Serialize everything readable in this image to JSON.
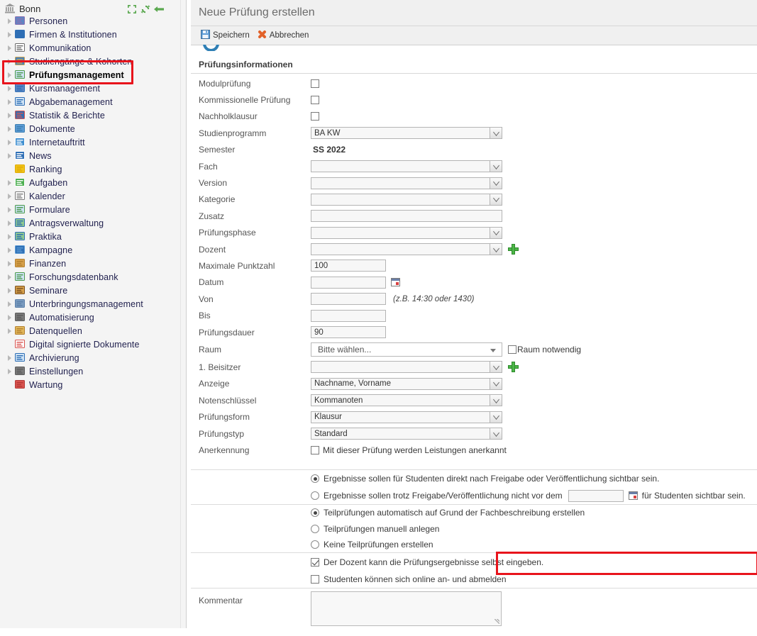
{
  "sidebar": {
    "root": {
      "label": "Bonn",
      "icon": "bank-icon"
    },
    "tools": [
      {
        "name": "collapse-all-icon",
        "label": "↕"
      },
      {
        "name": "refresh-icon",
        "label": "↻"
      },
      {
        "name": "back-arrow-icon",
        "label": "←"
      }
    ],
    "items": [
      {
        "label": "Personen",
        "icon": "people-icon",
        "expandable": true,
        "active": false
      },
      {
        "label": "Firmen & Institutionen",
        "icon": "factory-icon",
        "expandable": true,
        "active": false
      },
      {
        "label": "Kommunikation",
        "icon": "envelope-icon",
        "expandable": true,
        "active": false
      },
      {
        "label": "Studiengänge & Kohorten",
        "icon": "graduation-icon",
        "expandable": true,
        "active": false
      },
      {
        "label": "Prüfungsmanagement",
        "icon": "exam-icon",
        "expandable": true,
        "active": true
      },
      {
        "label": "Kursmanagement",
        "icon": "book-icon",
        "expandable": true,
        "active": false
      },
      {
        "label": "Abgabemanagement",
        "icon": "card-icon",
        "expandable": true,
        "active": false
      },
      {
        "label": "Statistik & Berichte",
        "icon": "bar-chart-icon",
        "expandable": true,
        "active": false
      },
      {
        "label": "Dokumente",
        "icon": "folder-icon",
        "expandable": true,
        "active": false
      },
      {
        "label": "Internetauftritt",
        "icon": "globe-icon",
        "expandable": true,
        "active": false
      },
      {
        "label": "News",
        "icon": "info-icon",
        "expandable": true,
        "active": false
      },
      {
        "label": "Ranking",
        "icon": "star-icon",
        "expandable": false,
        "active": false
      },
      {
        "label": "Aufgaben",
        "icon": "clock-icon",
        "expandable": true,
        "active": false
      },
      {
        "label": "Kalender",
        "icon": "calendar-icon",
        "expandable": true,
        "active": false
      },
      {
        "label": "Formulare",
        "icon": "form-icon",
        "expandable": true,
        "active": false
      },
      {
        "label": "Antragsverwaltung",
        "icon": "application-icon",
        "expandable": true,
        "active": false
      },
      {
        "label": "Praktika",
        "icon": "internship-icon",
        "expandable": true,
        "active": false
      },
      {
        "label": "Kampagne",
        "icon": "campaign-icon",
        "expandable": true,
        "active": false
      },
      {
        "label": "Finanzen",
        "icon": "coins-icon",
        "expandable": true,
        "active": false
      },
      {
        "label": "Forschungsdatenbank",
        "icon": "research-chart-icon",
        "expandable": true,
        "active": false
      },
      {
        "label": "Seminare",
        "icon": "briefcase-icon",
        "expandable": true,
        "active": false
      },
      {
        "label": "Unterbringungsmanagement",
        "icon": "building-icon",
        "expandable": true,
        "active": false
      },
      {
        "label": "Automatisierung",
        "icon": "gear-icon",
        "expandable": true,
        "active": false
      },
      {
        "label": "Datenquellen",
        "icon": "database-icon",
        "expandable": true,
        "active": false
      },
      {
        "label": "Digital signierte Dokumente",
        "icon": "signed-document-icon",
        "expandable": false,
        "active": false
      },
      {
        "label": "Archivierung",
        "icon": "archive-icon",
        "expandable": true,
        "active": false
      },
      {
        "label": "Einstellungen",
        "icon": "gear-icon",
        "expandable": true,
        "active": false
      },
      {
        "label": "Wartung",
        "icon": "toolbox-icon",
        "expandable": false,
        "active": false
      }
    ]
  },
  "header": {
    "title": "Neue Prüfung erstellen"
  },
  "toolbar": {
    "save_label": "Speichern",
    "save_icon": "floppy-disk-icon",
    "cancel_label": "Abbrechen",
    "cancel_icon": "red-x-icon"
  },
  "section": {
    "title": "Prüfungsinformationen"
  },
  "fields": {
    "modulpruefung": {
      "label": "Modulprüfung",
      "checked": false
    },
    "kommissionelle": {
      "label": "Kommissionelle Prüfung",
      "checked": false
    },
    "nachholklausur": {
      "label": "Nachholklausur",
      "checked": false
    },
    "studienprogramm": {
      "label": "Studienprogramm",
      "value": "BA KW"
    },
    "semester": {
      "label": "Semester",
      "value": "SS 2022"
    },
    "fach": {
      "label": "Fach",
      "value": ""
    },
    "version": {
      "label": "Version",
      "value": ""
    },
    "kategorie": {
      "label": "Kategorie",
      "value": ""
    },
    "zusatz": {
      "label": "Zusatz",
      "value": ""
    },
    "pruefungsphase": {
      "label": "Prüfungsphase",
      "value": ""
    },
    "dozent": {
      "label": "Dozent",
      "value": ""
    },
    "max_punktzahl": {
      "label": "Maximale Punktzahl",
      "value": "100"
    },
    "datum": {
      "label": "Datum",
      "value": ""
    },
    "von": {
      "label": "Von",
      "value": "",
      "hint": "(z.B. 14:30 oder 1430)"
    },
    "bis": {
      "label": "Bis",
      "value": ""
    },
    "pruefungsdauer": {
      "label": "Prüfungsdauer",
      "value": "90"
    },
    "raum": {
      "label": "Raum",
      "value": "Bitte wählen...",
      "side_label": "Raum notwendig",
      "side_checked": false
    },
    "beisitzer1": {
      "label": "1. Beisitzer",
      "value": ""
    },
    "anzeige": {
      "label": "Anzeige",
      "value": "Nachname, Vorname"
    },
    "notenschluessel": {
      "label": "Notenschlüssel",
      "value": "Kommanoten"
    },
    "pruefungsform": {
      "label": "Prüfungsform",
      "value": "Klausur"
    },
    "pruefungstyp": {
      "label": "Prüfungstyp",
      "value": "Standard"
    },
    "anerkennung": {
      "label": "Anerkennung",
      "text": "Mit dieser Prüfung werden Leistungen anerkannt",
      "checked": false
    },
    "kommentar": {
      "label": "Kommentar",
      "value": ""
    }
  },
  "visibility_options": [
    {
      "text": "Ergebnisse sollen für Studenten direkt nach Freigabe oder Veröffentlichung sichtbar sein.",
      "selected": true
    },
    {
      "text_before": "Ergebnisse sollen trotz Freigabe/Veröffentlichung nicht vor dem",
      "date_value": "",
      "text_after": "für Studenten sichtbar sein.",
      "selected": false
    }
  ],
  "partial_exam_options": [
    {
      "text": "Teilprüfungen automatisch auf Grund der Fachbeschreibung erstellen",
      "selected": true
    },
    {
      "text": "Teilprüfungen manuell anlegen",
      "selected": false
    },
    {
      "text": "Keine Teilprüfungen erstellen",
      "selected": false
    }
  ],
  "bottom_checkboxes": [
    {
      "text": "Der Dozent kann die Prüfungsergebnisse selbst eingeben.",
      "checked": true,
      "highlighted": true
    },
    {
      "text": "Studenten können sich online an- und abmelden",
      "checked": false,
      "highlighted": false
    }
  ],
  "colors": {
    "highlight": "#e8141c",
    "panel_bg": "#f0f0f0",
    "sidebar_bg": "#f4f4f4",
    "link_text": "#1f1f4d",
    "accent_green": "#4cb648"
  }
}
